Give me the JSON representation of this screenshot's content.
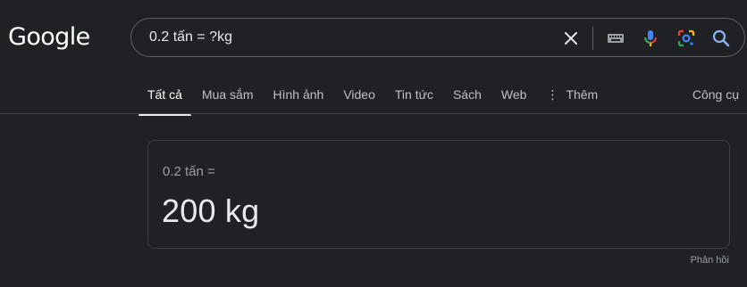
{
  "header": {
    "logo_text": "Google"
  },
  "search": {
    "query": "0.2 tấn = ?kg",
    "icons": [
      "close-icon",
      "keyboard-icon",
      "mic-icon",
      "lens-icon",
      "search-icon"
    ]
  },
  "tabs": [
    {
      "label": "Tất cả",
      "active": true
    },
    {
      "label": "Mua sắm",
      "active": false
    },
    {
      "label": "Hình ảnh",
      "active": false
    },
    {
      "label": "Video",
      "active": false
    },
    {
      "label": "Tin tức",
      "active": false
    },
    {
      "label": "Sách",
      "active": false
    },
    {
      "label": "Web",
      "active": false
    },
    {
      "label": "Thêm",
      "active": false
    }
  ],
  "tools_label": "Công cụ",
  "result": {
    "expression": "0.2 tấn =",
    "value": "200 kg"
  },
  "feedback_label": "Phản hồi",
  "colors": {
    "background": "#202124",
    "text": "#e8eaed",
    "muted": "#9aa0a6",
    "border": "#3c4043",
    "accent_blue": "#8ab4f8"
  }
}
